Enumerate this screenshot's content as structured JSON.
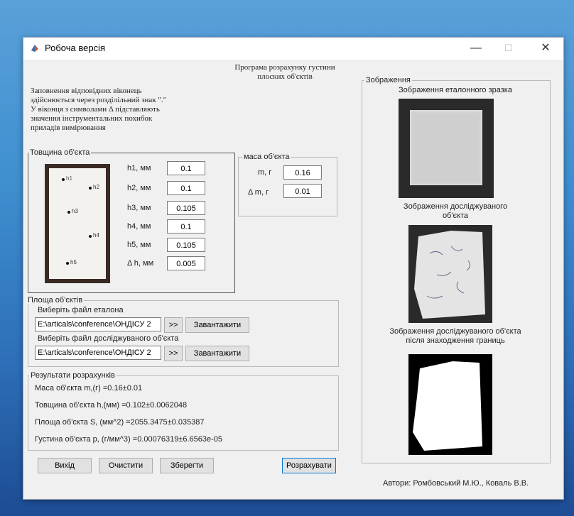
{
  "window": {
    "title": "Робоча версія",
    "minimize_glyph": "—",
    "maximize_glyph": "☐",
    "close_glyph": "✕"
  },
  "program": {
    "title_line1": "Програма розрахунку густини",
    "title_line2": "плоских об'єктів"
  },
  "instructions": {
    "line1": "Заповнення відповідних віконець",
    "line2": "здійснюється через розділільний знак \".\"",
    "line3": "У віконця з символами Δ підставляють",
    "line4": "значення інструментальних похибок",
    "line5": "приладів вимірювання"
  },
  "thickness": {
    "legend": "Товщина об'єкта",
    "point_labels": [
      "h1",
      "h2",
      "h3",
      "h4",
      "h5"
    ],
    "rows": [
      {
        "label": "h1, мм",
        "value": "0.1"
      },
      {
        "label": "h2, мм",
        "value": "0.1"
      },
      {
        "label": "h3, мм",
        "value": "0.105"
      },
      {
        "label": "h4, мм",
        "value": "0.1"
      },
      {
        "label": "h5, мм",
        "value": "0.105"
      },
      {
        "label": "Δ h, мм",
        "value": "0.005"
      }
    ]
  },
  "mass": {
    "legend": "маса об'єкта",
    "m_label": "m, г",
    "m_value": "0.16",
    "dm_label": "Δ m, г",
    "dm_value": "0.01"
  },
  "area": {
    "legend": "Площа об'єктів",
    "ref_label": "Виберіть файл еталона",
    "ref_path": "E:\\articals\\conference\\ОНДІСУ 2",
    "sample_label": "Виберіть файл досліджуваного об'єкта",
    "sample_path": "E:\\articals\\conference\\ОНДІСУ 2",
    "browse_label": ">>",
    "load_label": "Завантажити"
  },
  "results": {
    "legend": "Результати розрахунків",
    "mass": "Маса об'єкта m,(г) =0.16±0.01",
    "thickness": "Товщина об'єкта h,(мм) =0.102±0.0062048",
    "area": "Площа об'єкта S, (мм^2) =2055.3475±0.035387",
    "density": "Густина об'єкта р, (г/мм^3) =0.00076319±6.6563е-05"
  },
  "buttons": {
    "exit": "Вихід",
    "clear": "Очистити",
    "save": "Зберегти",
    "calculate": "Розрахувати"
  },
  "images": {
    "legend": "Зображення",
    "reference_title": "Зображення еталонного зразка",
    "sample_title_line1": "Зображення досліджуваного",
    "sample_title_line2": "об'єкта",
    "boundary_title_line1": "Зображення досліджуваного об'єкта",
    "boundary_title_line2": "після знаходження границь"
  },
  "authors": "Автори: Ромбовський М.Ю., Коваль В.В.",
  "colors": {
    "window_bg": "#f0f0f0",
    "desktop": "#3f8fd0"
  }
}
